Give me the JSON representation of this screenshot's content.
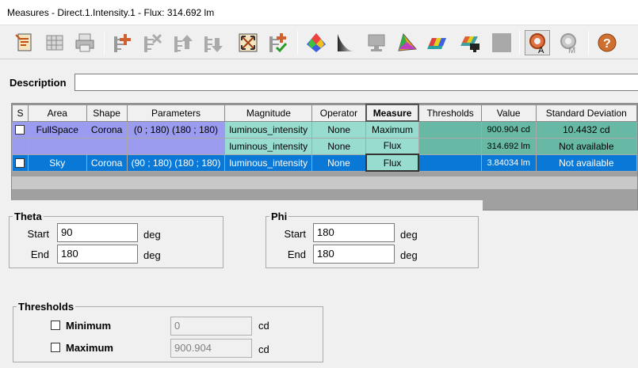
{
  "window": {
    "title": "Measures - Direct.1.Intensity.1 - Flux: 314.692 lm"
  },
  "toolbar": {
    "icons": [
      "edit-document-icon",
      "grid-icon",
      "print-icon",
      "add-measure-icon",
      "delete-measure-icon",
      "move-up-icon",
      "move-down-icon",
      "fit-view-icon",
      "add-validated-measure-icon",
      "color-scale-icon",
      "gradient-icon",
      "monitor-icon",
      "color-gamut-icon",
      "spectrum-3d-icon",
      "display-3d-icon",
      "gray-square-icon",
      "automatic-mode-icon",
      "manual-mode-icon",
      "help-icon"
    ],
    "mode_a_label": "A",
    "mode_m_label": "M",
    "help_label": "?"
  },
  "description": {
    "label": "Description",
    "value": ""
  },
  "grid": {
    "headers": [
      "S",
      "Area",
      "Shape",
      "Parameters",
      "Magnitude",
      "Operator",
      "Measure",
      "Thresholds",
      "Value",
      "Standard Deviation"
    ],
    "rows": [
      {
        "area": "FullSpace",
        "shape": "Corona",
        "parameters": "(0 ; 180) (180 ; 180)",
        "magnitude": "luminous_intensity",
        "operator": "None",
        "measure": "Maximum",
        "thresholds": "",
        "value": "900.904 cd",
        "std": "10.4432 cd"
      },
      {
        "area": "",
        "shape": "",
        "parameters": "",
        "magnitude": "luminous_intensity",
        "operator": "None",
        "measure": "Flux",
        "thresholds": "",
        "value": "314.692 lm",
        "std": "Not available"
      },
      {
        "area": "Sky",
        "shape": "Corona",
        "parameters": "(90 ; 180) (180 ; 180)",
        "magnitude": "luminous_intensity",
        "operator": "None",
        "measure": "Flux",
        "thresholds": "",
        "value": "3.84034 lm",
        "std": "Not available"
      }
    ]
  },
  "theta": {
    "title": "Theta",
    "start_label": "Start",
    "start_value": "90",
    "end_label": "End",
    "end_value": "180",
    "unit": "deg"
  },
  "phi": {
    "title": "Phi",
    "start_label": "Start",
    "start_value": "180",
    "end_label": "End",
    "end_value": "180",
    "unit": "deg"
  },
  "thresholds": {
    "title": "Thresholds",
    "minimum_label": "Minimum",
    "minimum_value": "0",
    "maximum_label": "Maximum",
    "maximum_value": "900.904",
    "unit": "cd"
  }
}
